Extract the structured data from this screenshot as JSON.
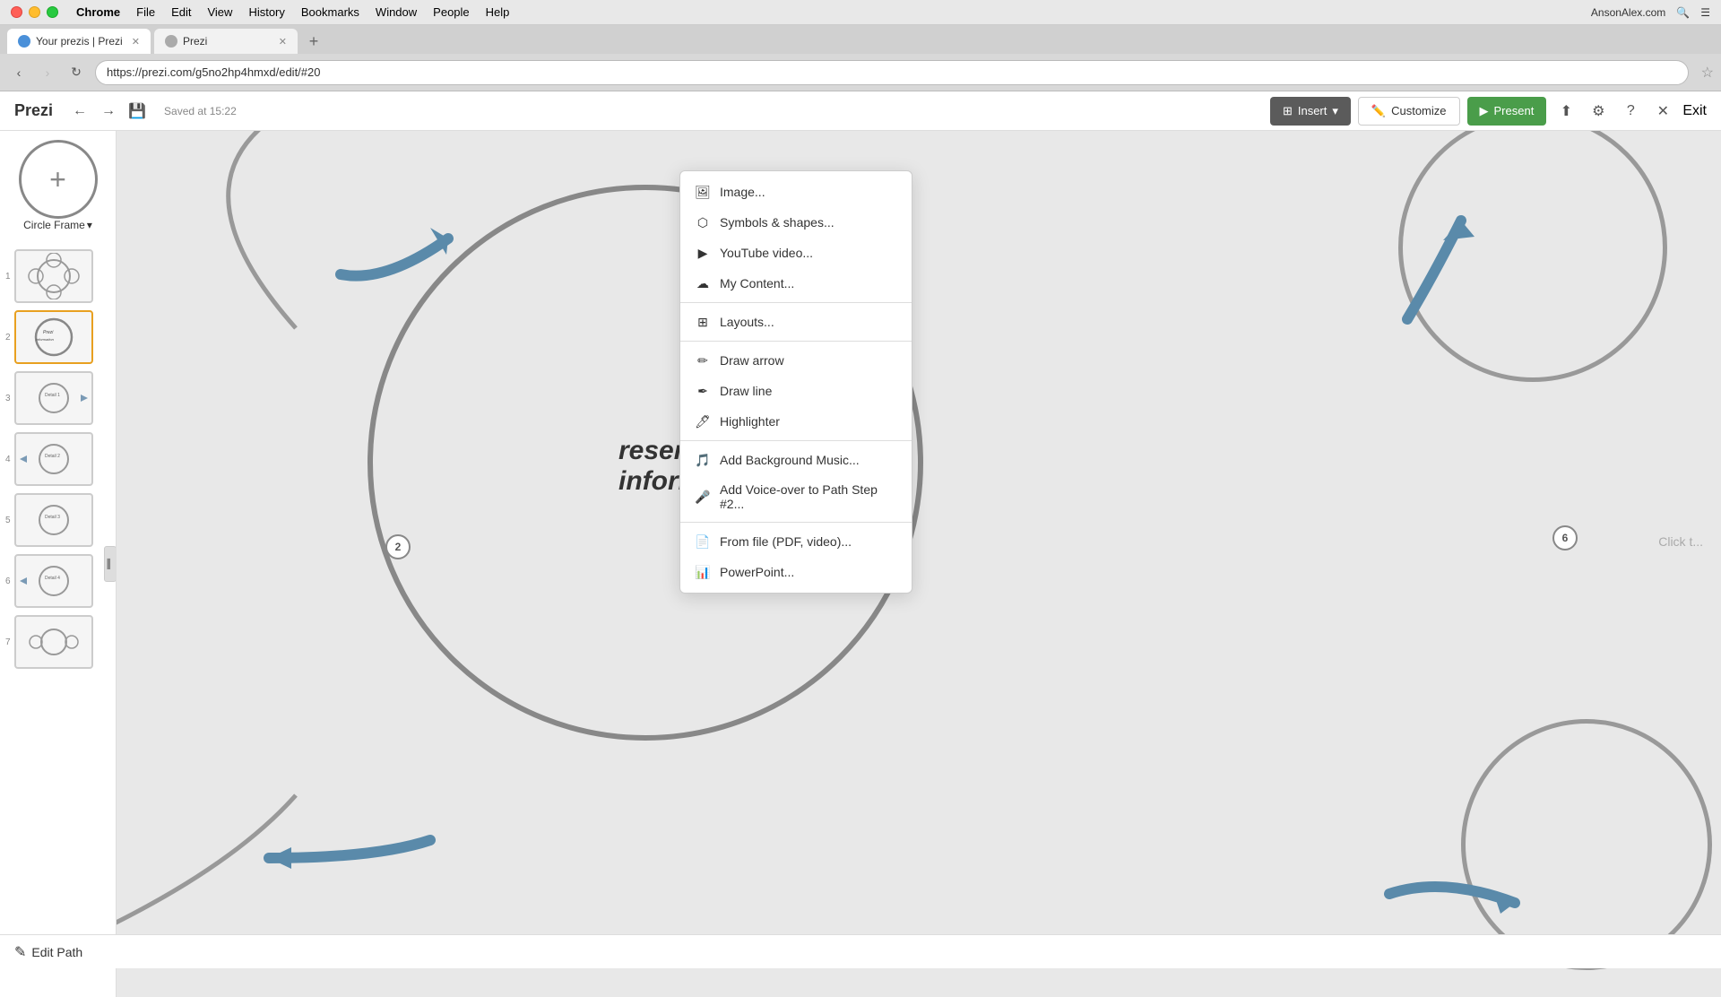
{
  "os": {
    "menu": [
      "Chrome",
      "File",
      "Edit",
      "View",
      "History",
      "Bookmarks",
      "Window",
      "People",
      "Help"
    ],
    "right_info": "AnsonAlex.com",
    "user": "Anson"
  },
  "browser": {
    "tabs": [
      {
        "label": "Your prezis | Prezi",
        "active": true
      },
      {
        "label": "Prezi",
        "active": false
      }
    ],
    "url": "https://prezi.com/g5no2hp4hmxd/edit/#20",
    "back_disabled": false
  },
  "toolbar": {
    "app_name": "Prezi",
    "save_status": "Saved at 15:22",
    "insert_label": "Insert",
    "customize_label": "Customize",
    "present_label": "Present",
    "exit_label": "Exit"
  },
  "sidebar": {
    "frame_label": "Circle Frame",
    "slides": [
      {
        "num": "1",
        "active": false
      },
      {
        "num": "2",
        "active": true
      },
      {
        "num": "3",
        "active": false
      },
      {
        "num": "4",
        "active": false
      },
      {
        "num": "5",
        "active": false
      },
      {
        "num": "6",
        "active": false
      },
      {
        "num": "7",
        "active": false
      }
    ]
  },
  "insert_menu": {
    "items": [
      {
        "icon": "image",
        "label": "Image..."
      },
      {
        "icon": "shapes",
        "label": "Symbols & shapes..."
      },
      {
        "icon": "video",
        "label": "YouTube video..."
      },
      {
        "icon": "content",
        "label": "My Content..."
      },
      {
        "separator": true
      },
      {
        "icon": "layouts",
        "label": "Layouts..."
      },
      {
        "separator": true
      },
      {
        "icon": "arrow",
        "label": "Draw arrow"
      },
      {
        "icon": "line",
        "label": "Draw line"
      },
      {
        "icon": "highlighter",
        "label": "Highlighter"
      },
      {
        "separator": true
      },
      {
        "icon": "music",
        "label": "Add Background Music..."
      },
      {
        "icon": "voice",
        "label": "Add Voice-over to Path Step #2..."
      },
      {
        "separator": true
      },
      {
        "icon": "file",
        "label": "From file (PDF, video)..."
      },
      {
        "icon": "ppt",
        "label": "PowerPoint..."
      }
    ]
  },
  "canvas": {
    "text": "resent\ninformation and ideas",
    "step2_label": "2",
    "step6_label": "6",
    "click_hint": "Click t..."
  },
  "bottom": {
    "edit_path_label": "Edit Path"
  }
}
